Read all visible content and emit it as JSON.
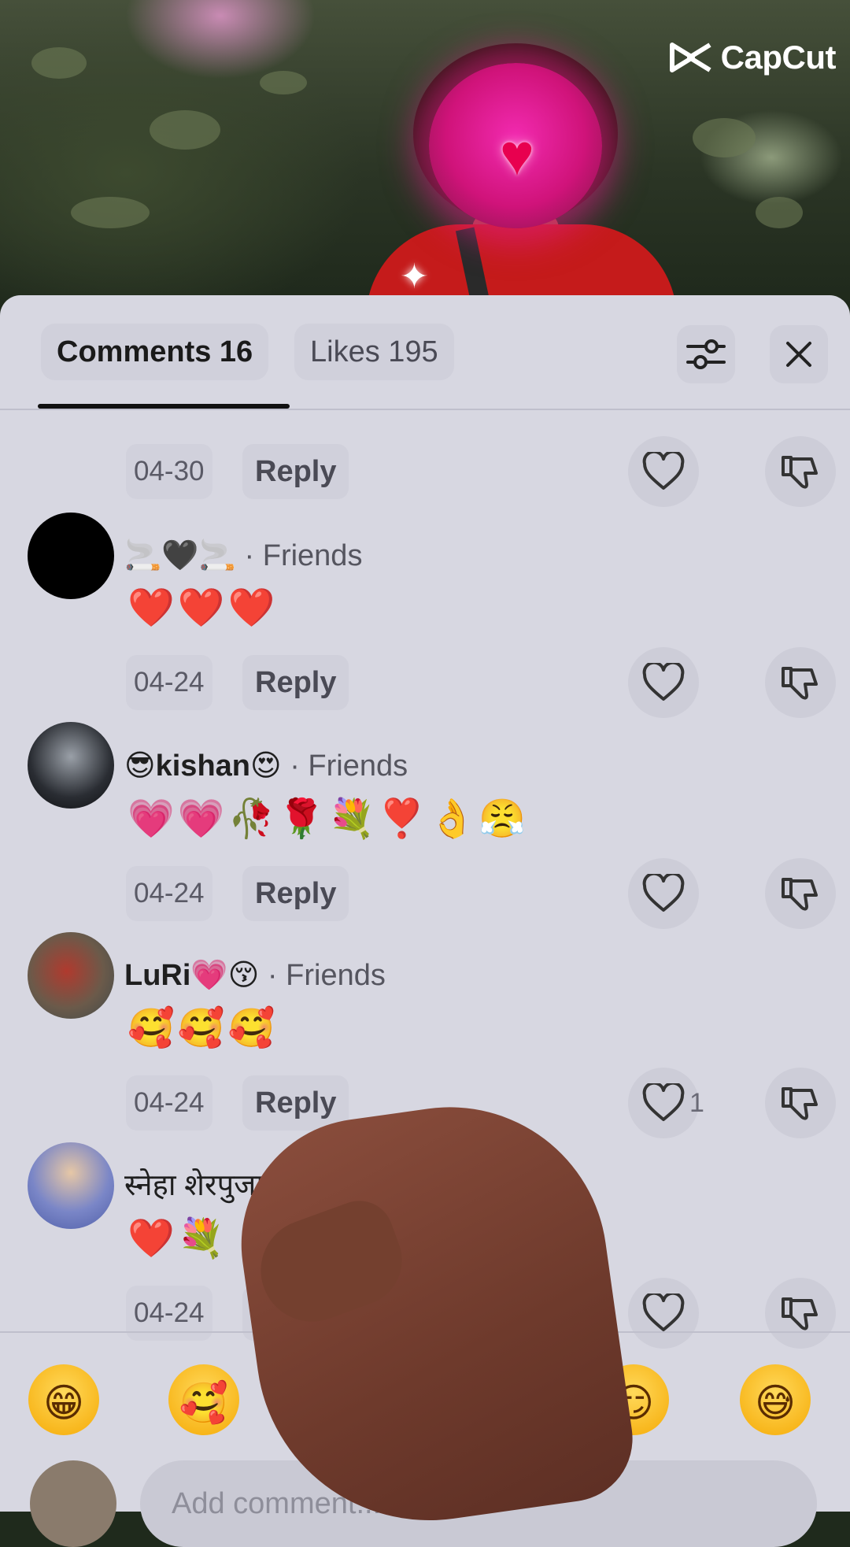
{
  "watermark": {
    "brand": "CapCut"
  },
  "header": {
    "tab_comments": "Comments 16",
    "tab_likes": "Likes 195"
  },
  "comments": [
    {
      "user": "",
      "tag": "",
      "text": "",
      "date": "04-30",
      "reply": "Reply",
      "likes": ""
    },
    {
      "user": "🚬🖤🚬",
      "tag": "· Friends",
      "text": "❤️❤️❤️",
      "date": "04-24",
      "reply": "Reply",
      "likes": ""
    },
    {
      "user": "😎kishan😍",
      "tag": "· Friends",
      "text": "💗💗🥀🌹💐❣️👌😤",
      "date": "04-24",
      "reply": "Reply",
      "likes": ""
    },
    {
      "user": "LuRi💗😚",
      "tag": "· Friends",
      "text": "🥰🥰🥰",
      "date": "04-24",
      "reply": "Reply",
      "likes": "1"
    },
    {
      "user": "स्नेहा शेरपुजा म",
      "tag": "",
      "text": "❤️💐",
      "date": "04-24",
      "reply": "Re",
      "likes": ""
    }
  ],
  "emoji_bar": [
    "😁",
    "🥰",
    "😂",
    "",
    "😏",
    "😅"
  ],
  "input": {
    "placeholder": "Add comment..."
  },
  "colors": {
    "sheet_bg": "#d7d7e1",
    "accent_text": "#111111"
  }
}
